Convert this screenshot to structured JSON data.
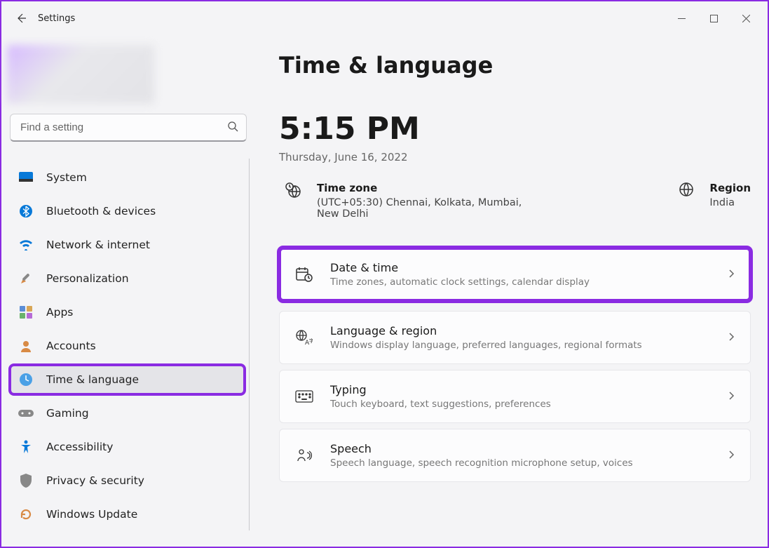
{
  "app": {
    "title": "Settings"
  },
  "search": {
    "placeholder": "Find a setting"
  },
  "nav": {
    "items": [
      {
        "label": "System"
      },
      {
        "label": "Bluetooth & devices"
      },
      {
        "label": "Network & internet"
      },
      {
        "label": "Personalization"
      },
      {
        "label": "Apps"
      },
      {
        "label": "Accounts"
      },
      {
        "label": "Time & language"
      },
      {
        "label": "Gaming"
      },
      {
        "label": "Accessibility"
      },
      {
        "label": "Privacy & security"
      },
      {
        "label": "Windows Update"
      }
    ]
  },
  "page": {
    "title": "Time & language",
    "time": "5:15 PM",
    "date": "Thursday, June 16, 2022",
    "timezone_label": "Time zone",
    "timezone_value": "(UTC+05:30) Chennai, Kolkata, Mumbai, New Delhi",
    "region_label": "Region",
    "region_value": "India"
  },
  "cards": [
    {
      "title": "Date & time",
      "desc": "Time zones, automatic clock settings, calendar display"
    },
    {
      "title": "Language & region",
      "desc": "Windows display language, preferred languages, regional formats"
    },
    {
      "title": "Typing",
      "desc": "Touch keyboard, text suggestions, preferences"
    },
    {
      "title": "Speech",
      "desc": "Speech language, speech recognition microphone setup, voices"
    }
  ]
}
